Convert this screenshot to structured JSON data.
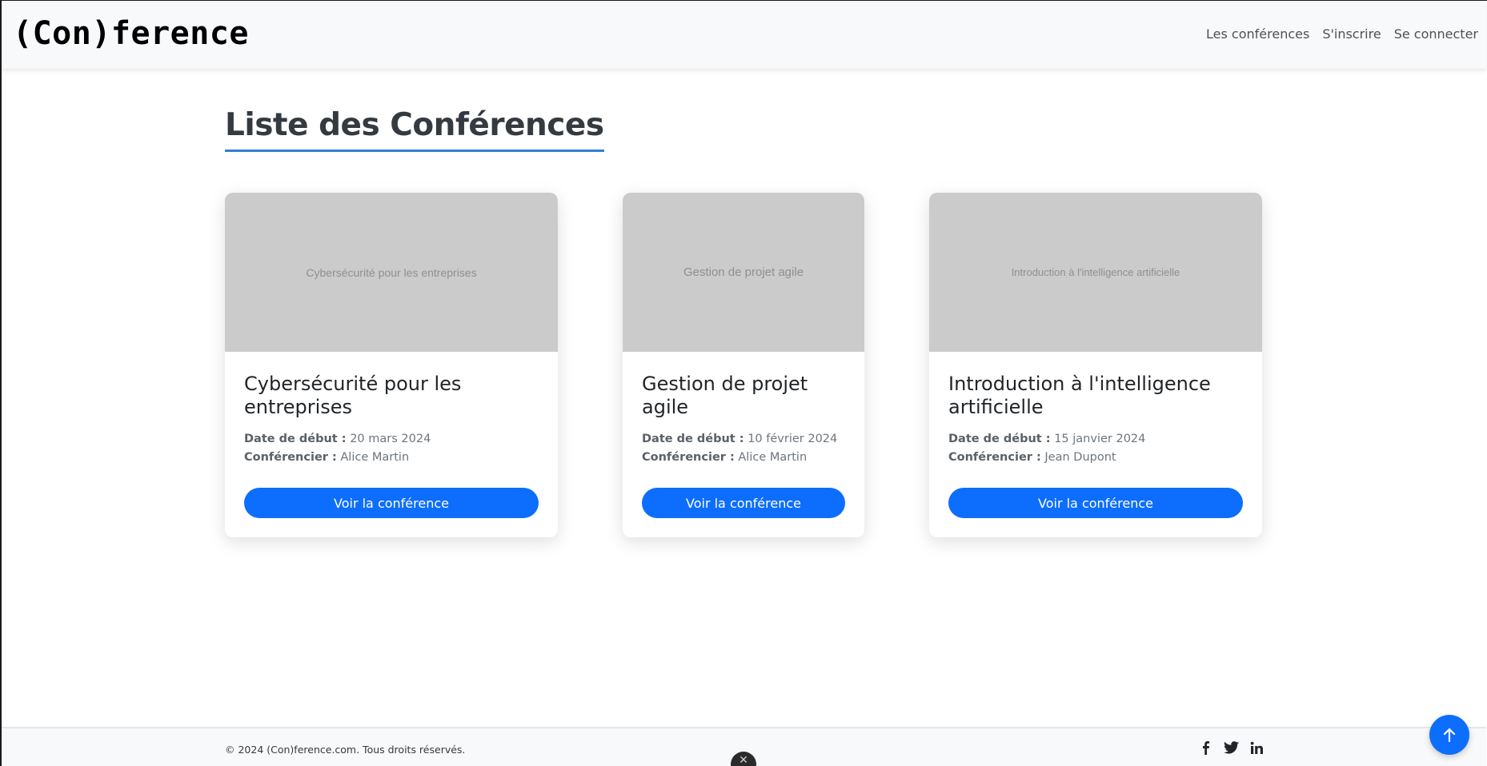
{
  "header": {
    "brand": "(Con)ference",
    "nav": [
      "Les conférences",
      "S'inscrire",
      "Se connecter"
    ]
  },
  "main": {
    "title": "Liste des Conférences",
    "button_label": "Voir la conférence",
    "date_label": "Date de début :",
    "speaker_label": "Conférencier :",
    "cards": [
      {
        "image_text": "Cybersécurité pour les entreprises",
        "title": "Cybersécurité pour les entreprises",
        "date": "20 mars 2024",
        "speaker": "Alice Martin"
      },
      {
        "image_text": "Gestion de projet agile",
        "title": "Gestion de projet agile",
        "date": "10 février 2024",
        "speaker": "Alice Martin"
      },
      {
        "image_text": "Introduction à l'intelligence artificielle",
        "title": "Introduction à l'intelligence artificielle",
        "date": "15 janvier 2024",
        "speaker": "Jean Dupont"
      }
    ]
  },
  "footer": {
    "copyright": "© 2024 (Con)ference.com. Tous droits réservés.",
    "socials": [
      "facebook-icon",
      "twitter-icon",
      "linkedin-icon"
    ]
  },
  "colors": {
    "primary": "#0d6efd",
    "title_underline": "#2f80d8",
    "header_bg": "#f8f9fa",
    "placeholder_bg": "#cbcbcb"
  },
  "icons": {
    "scroll_top": "arrow-up-icon",
    "floating": "x-icon"
  }
}
